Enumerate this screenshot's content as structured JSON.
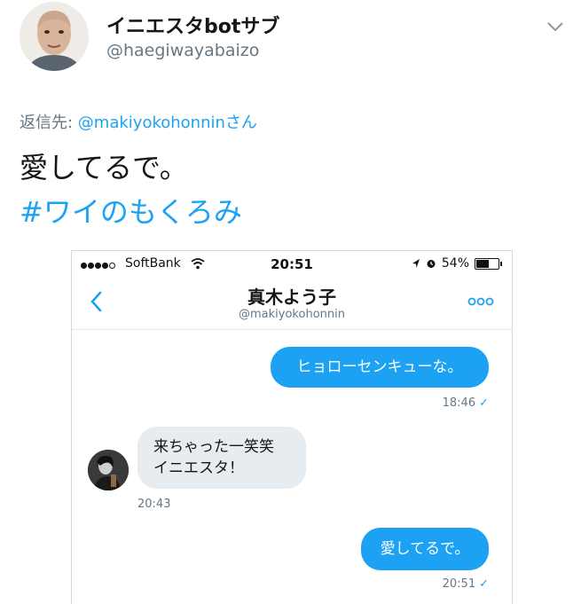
{
  "tweet": {
    "display_name": "イニエスタbotサブ",
    "handle": "@haegiwayabaizo",
    "reply_prefix": "返信先: ",
    "reply_to": "@makiyokohonninさん",
    "text": "愛してるで。",
    "hashtag": "#ワイのもくろみ"
  },
  "phone": {
    "status_bar": {
      "carrier": "SoftBank",
      "time": "20:51",
      "battery": "54%",
      "battery_level": 0.54
    },
    "conversation": {
      "title": "真木よう子",
      "subtitle": "@makiyokohonnin"
    },
    "messages": [
      {
        "direction": "out",
        "text": "ヒョローセンキューな。",
        "time": "18:46"
      },
      {
        "direction": "in",
        "lines": [
          "来ちゃった一笑笑",
          "イニエスタ！"
        ],
        "time": "20:43"
      },
      {
        "direction": "out",
        "text": "愛してるで。",
        "time": "20:51"
      }
    ]
  },
  "colors": {
    "accent": "#1da1f2",
    "muted": "#657786",
    "incoming_bubble": "#e6ecf0"
  },
  "icons": [
    "chevron-down-icon",
    "wifi-icon",
    "location-arrow-icon",
    "alarm-icon",
    "battery-icon",
    "back-chevron-icon",
    "more-dots-icon",
    "checkmark-icon"
  ]
}
